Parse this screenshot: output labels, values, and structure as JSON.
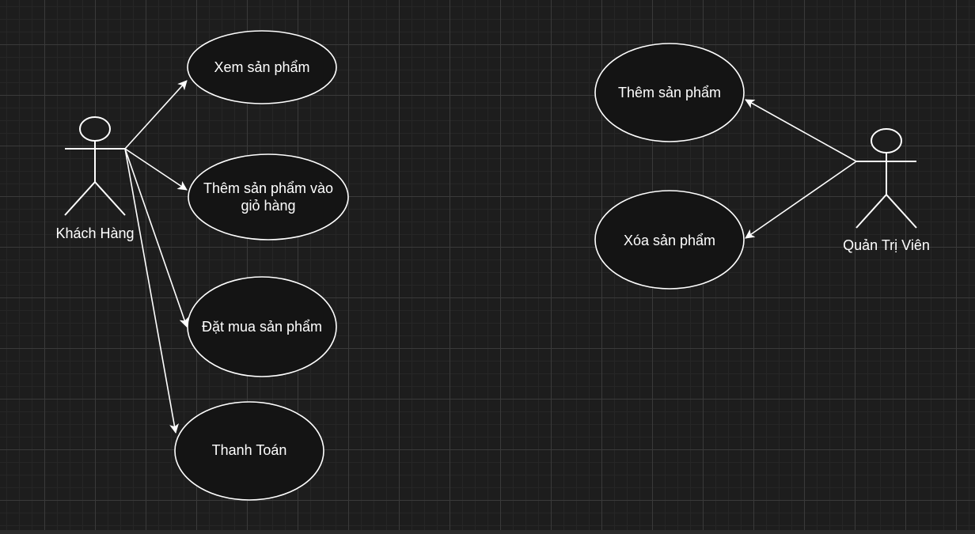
{
  "actors": {
    "customer": {
      "label": "Khách Hàng"
    },
    "admin": {
      "label": "Quản Trị Viên"
    }
  },
  "use_cases": {
    "view_products": "Xem sản phẩm",
    "add_to_cart": "Thêm sản phẩm vào giỏ hàng",
    "order_products": "Đặt mua sản phẩm",
    "payment": "Thanh Toán",
    "add_product": "Thêm sản phẩm",
    "delete_product": "Xóa sản phẩm"
  },
  "colors": {
    "background": "#1d1d1d",
    "stroke": "#ffffff",
    "ellipse_fill": "#141414"
  }
}
